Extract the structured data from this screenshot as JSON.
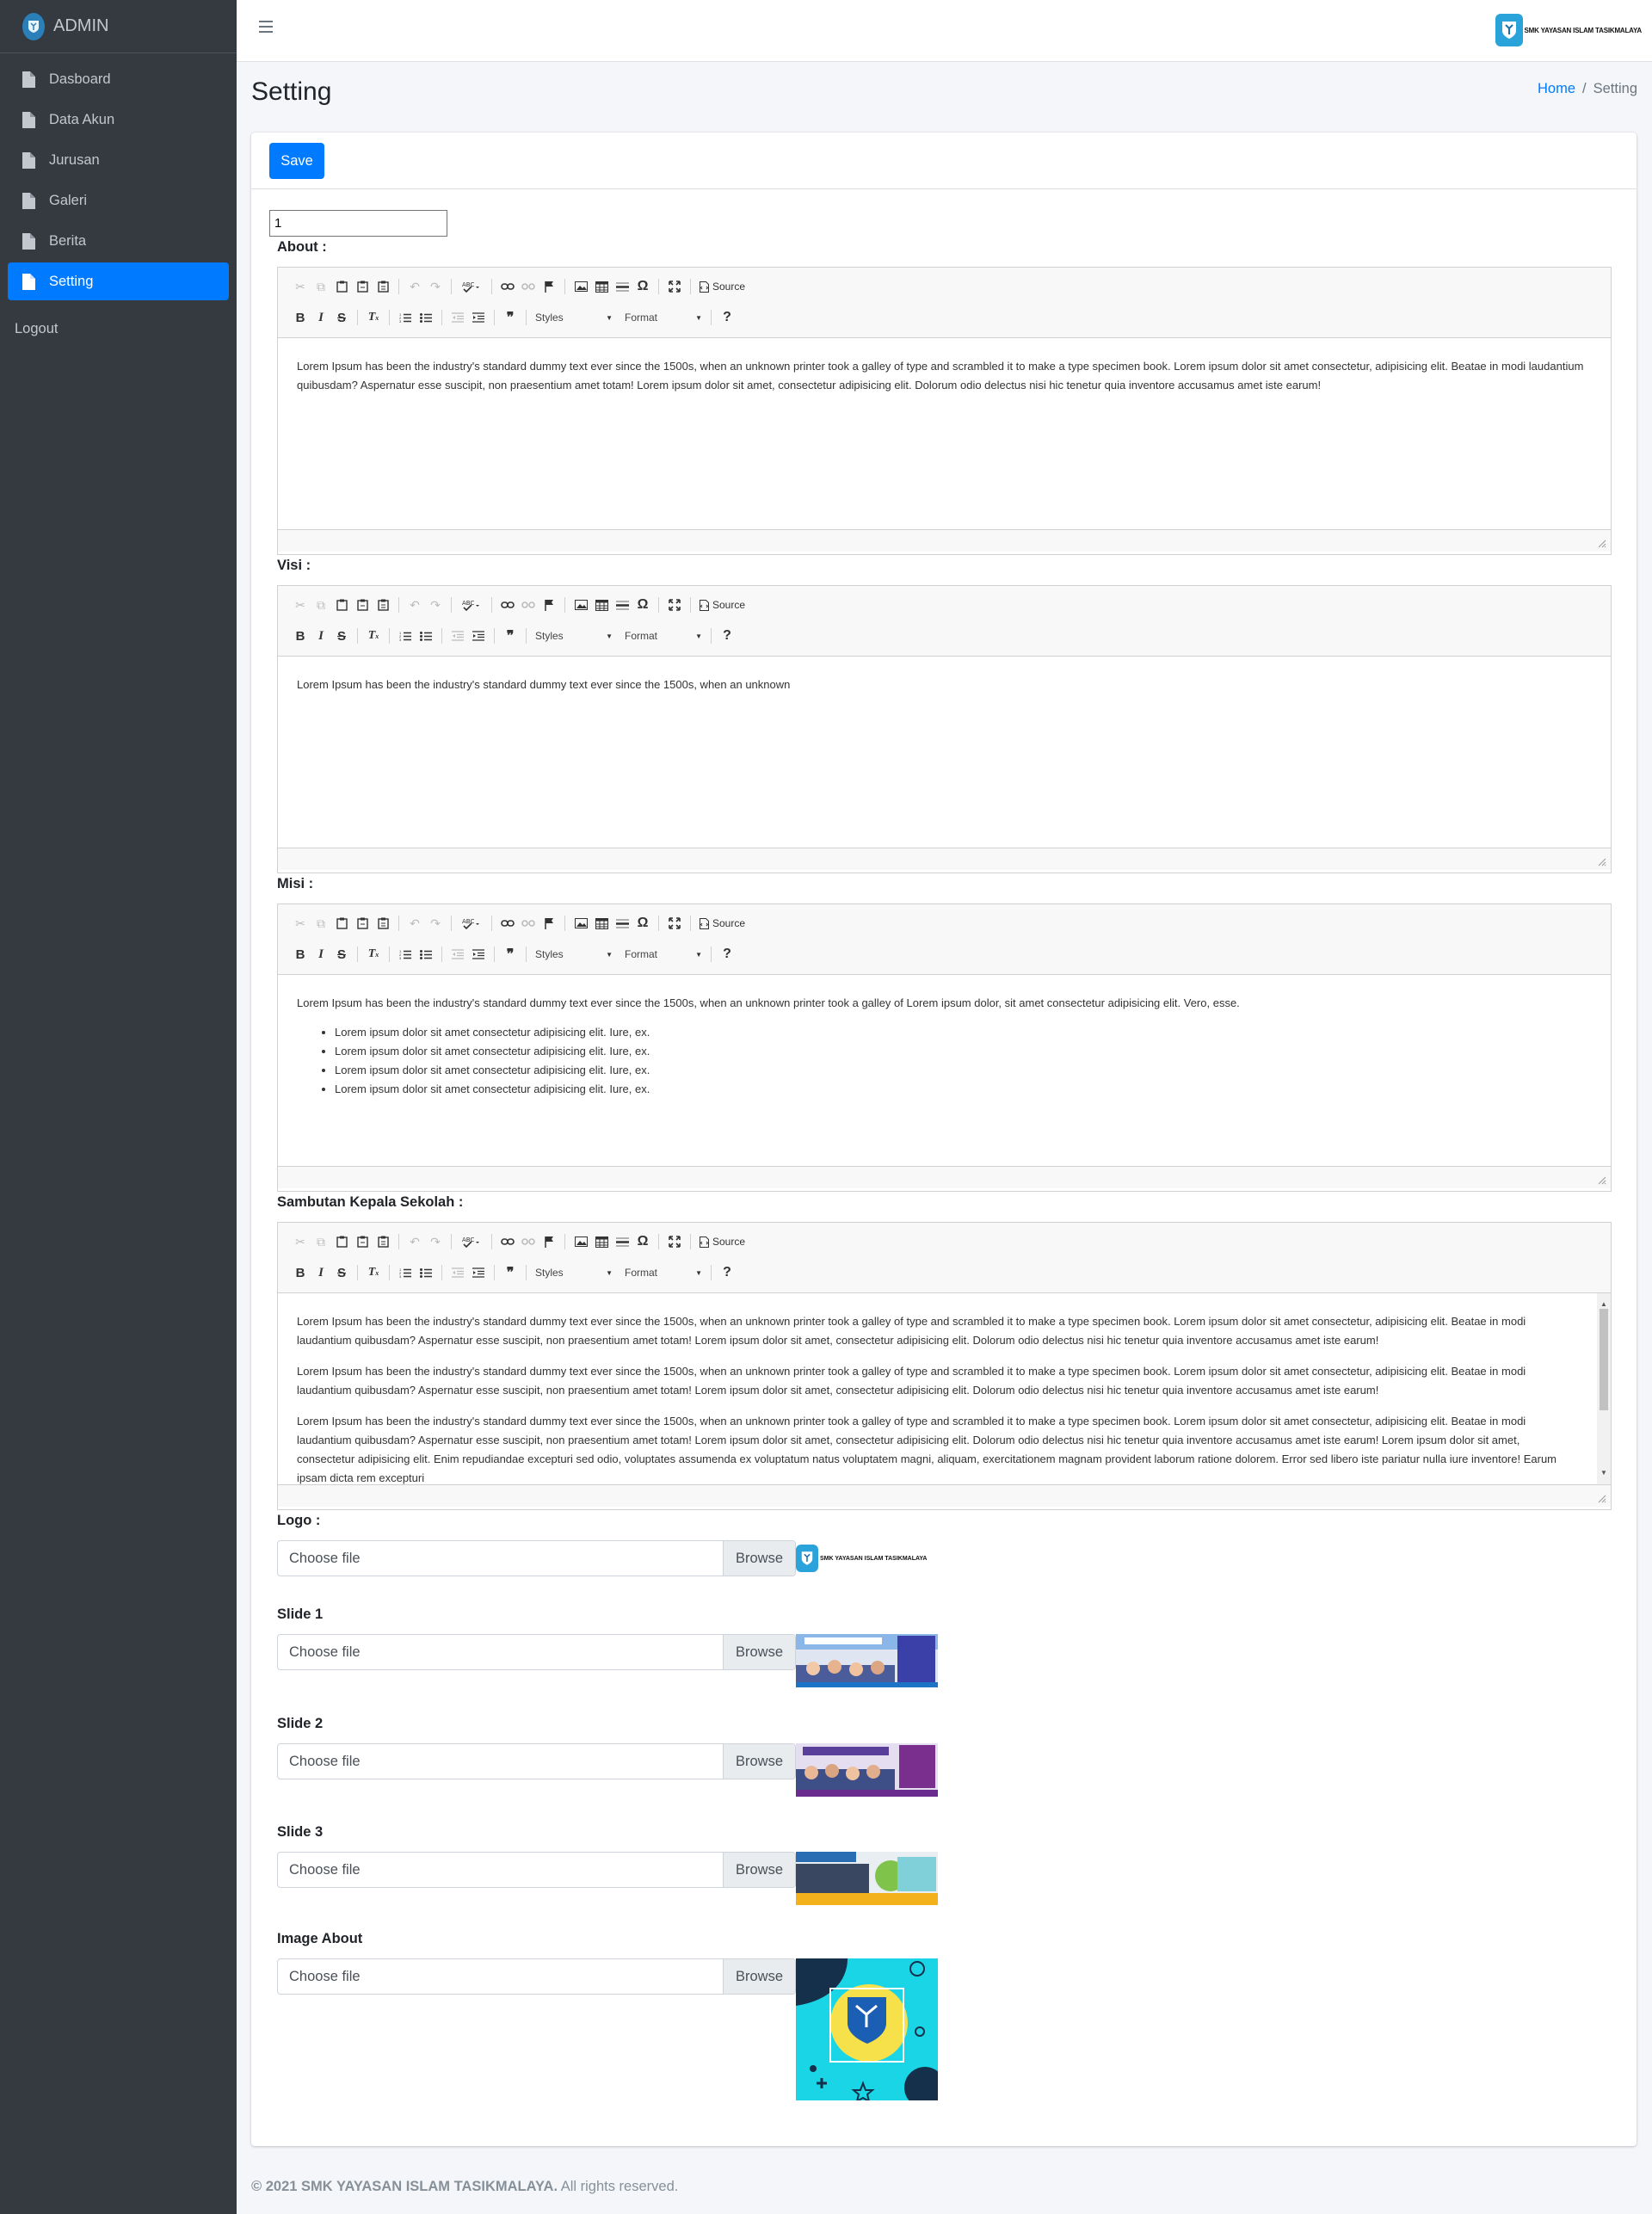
{
  "sidebar": {
    "brand": "ADMIN",
    "items": [
      {
        "label": "Dasboard",
        "active": false
      },
      {
        "label": "Data Akun",
        "active": false
      },
      {
        "label": "Jurusan",
        "active": false
      },
      {
        "label": "Galeri",
        "active": false
      },
      {
        "label": "Berita",
        "active": false
      },
      {
        "label": "Setting",
        "active": true
      }
    ],
    "logout": "Logout"
  },
  "header": {
    "school_name": "SMK YAYASAN ISLAM TASIKMALAYA",
    "menu_icon": "hamburger-icon"
  },
  "page": {
    "title": "Setting",
    "breadcrumb": {
      "home": "Home",
      "separator": "/",
      "current": "Setting"
    }
  },
  "form": {
    "save_label": "Save",
    "id_value": "1",
    "editors": [
      {
        "label": "About :",
        "paragraphs": [
          "Lorem Ipsum has been the industry's standard dummy text ever since the 1500s, when an unknown printer took a galley of type and scrambled it to make a type specimen book. Lorem ipsum dolor sit amet consectetur, adipisicing elit. Beatae in modi laudantium quibusdam? Aspernatur esse suscipit, non praesentium amet totam! Lorem ipsum dolor sit amet, consectetur adipisicing elit. Dolorum odio delectus nisi hic tenetur quia inventore accusamus amet iste earum!"
        ]
      },
      {
        "label": "Visi :",
        "paragraphs": [
          "Lorem Ipsum has been the industry's standard dummy text ever since the 1500s, when an unknown"
        ]
      },
      {
        "label": "Misi :",
        "paragraphs": [
          "Lorem Ipsum has been the industry's standard dummy text ever since the 1500s, when an unknown printer took a galley of Lorem ipsum dolor, sit amet consectetur adipisicing elit. Vero, esse."
        ],
        "bullets": [
          "Lorem ipsum dolor sit amet consectetur adipisicing elit. Iure, ex.",
          "Lorem ipsum dolor sit amet consectetur adipisicing elit. Iure, ex.",
          "Lorem ipsum dolor sit amet consectetur adipisicing elit. Iure, ex.",
          "Lorem ipsum dolor sit amet consectetur adipisicing elit. Iure, ex."
        ]
      },
      {
        "label": "Sambutan Kepala Sekolah :",
        "paragraphs": [
          "Lorem Ipsum has been the industry's standard dummy text ever since the 1500s, when an unknown printer took a galley of type and scrambled it to make a type specimen book. Lorem ipsum dolor sit amet consectetur, adipisicing elit. Beatae in modi laudantium quibusdam? Aspernatur esse suscipit, non praesentium amet totam! Lorem ipsum dolor sit amet, consectetur adipisicing elit. Dolorum odio delectus nisi hic tenetur quia inventore accusamus amet iste earum!",
          "Lorem Ipsum has been the industry's standard dummy text ever since the 1500s, when an unknown printer took a galley of type and scrambled it to make a type specimen book. Lorem ipsum dolor sit amet consectetur, adipisicing elit. Beatae in modi laudantium quibusdam? Aspernatur esse suscipit, non praesentium amet totam! Lorem ipsum dolor sit amet, consectetur adipisicing elit. Dolorum odio delectus nisi hic tenetur quia inventore accusamus amet iste earum!",
          "Lorem Ipsum has been the industry's standard dummy text ever since the 1500s, when an unknown printer took a galley of type and scrambled it to make a type specimen book. Lorem ipsum dolor sit amet consectetur, adipisicing elit. Beatae in modi laudantium quibusdam? Aspernatur esse suscipit, non praesentium amet totam! Lorem ipsum dolor sit amet, consectetur adipisicing elit. Dolorum odio delectus nisi hic tenetur quia inventore accusamus amet iste earum! Lorem ipsum dolor sit amet, consectetur adipisicing elit. Enim repudiandae excepturi sed odio, voluptates assumenda ex voluptatum natus voluptatem magni, aliquam, exercitationem magnam provident laborum ratione dolorem. Error sed libero iste pariatur nulla iure inventore! Earum ipsam dicta rem excepturi"
        ]
      }
    ],
    "toolbar": {
      "source_label": "Source",
      "styles_label": "Styles",
      "format_label": "Format"
    },
    "files": [
      {
        "label": "Logo :",
        "placeholder": "Choose file",
        "browse": "Browse",
        "preview_text": "SMK YAYASAN ISLAM TASIKMALAYA"
      },
      {
        "label": "Slide 1",
        "placeholder": "Choose file",
        "browse": "Browse"
      },
      {
        "label": "Slide 2",
        "placeholder": "Choose file",
        "browse": "Browse"
      },
      {
        "label": "Slide 3",
        "placeholder": "Choose file",
        "browse": "Browse"
      },
      {
        "label": "Image About",
        "placeholder": "Choose file",
        "browse": "Browse"
      }
    ]
  },
  "footer": {
    "copyright": "© 2021 SMK YAYASAN ISLAM TASIKMALAYA.",
    "rights": " All rights reserved."
  },
  "colors": {
    "sidebar_bg": "#343a40",
    "accent": "#007bff",
    "page_bg": "#f4f6f9"
  }
}
